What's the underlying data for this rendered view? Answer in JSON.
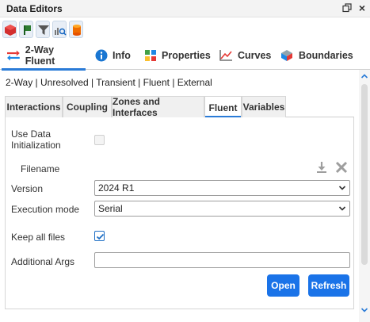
{
  "window": {
    "title": "Data Editors"
  },
  "toolbar_icons": [
    "red-cube-icon",
    "green-flag-icon",
    "filter-icon",
    "search-chart-icon",
    "cylinder-icon"
  ],
  "main_tabs": [
    {
      "label": "2-Way Fluent",
      "icon": "fluent-arrows-icon",
      "active": true
    },
    {
      "label": "Info",
      "icon": "info-icon",
      "active": false
    },
    {
      "label": "Properties",
      "icon": "properties-icon",
      "active": false
    },
    {
      "label": "Curves",
      "icon": "curves-icon",
      "active": false
    },
    {
      "label": "Boundaries",
      "icon": "boundaries-icon",
      "active": false
    }
  ],
  "breadcrumb": "2-Way | Unresolved | Transient | Fluent | External",
  "sub_tabs": [
    {
      "label": "Interactions",
      "active": false
    },
    {
      "label": "Coupling",
      "active": false
    },
    {
      "label": "Zones and Interfaces",
      "active": false
    },
    {
      "label": "Fluent",
      "active": true
    },
    {
      "label": "Variables",
      "active": false
    }
  ],
  "form": {
    "use_data_init_label": "Use Data Initialization",
    "use_data_init_checked": false,
    "filename_label": "Filename",
    "version_label": "Version",
    "version_value": "2024 R1",
    "execution_mode_label": "Execution mode",
    "execution_mode_value": "Serial",
    "keep_all_files_label": "Keep all files",
    "keep_all_files_checked": true,
    "additional_args_label": "Additional Args",
    "additional_args_value": ""
  },
  "buttons": {
    "open": "Open",
    "refresh": "Refresh"
  },
  "colors": {
    "accent": "#2a7bd7",
    "button": "#1a73e8"
  }
}
